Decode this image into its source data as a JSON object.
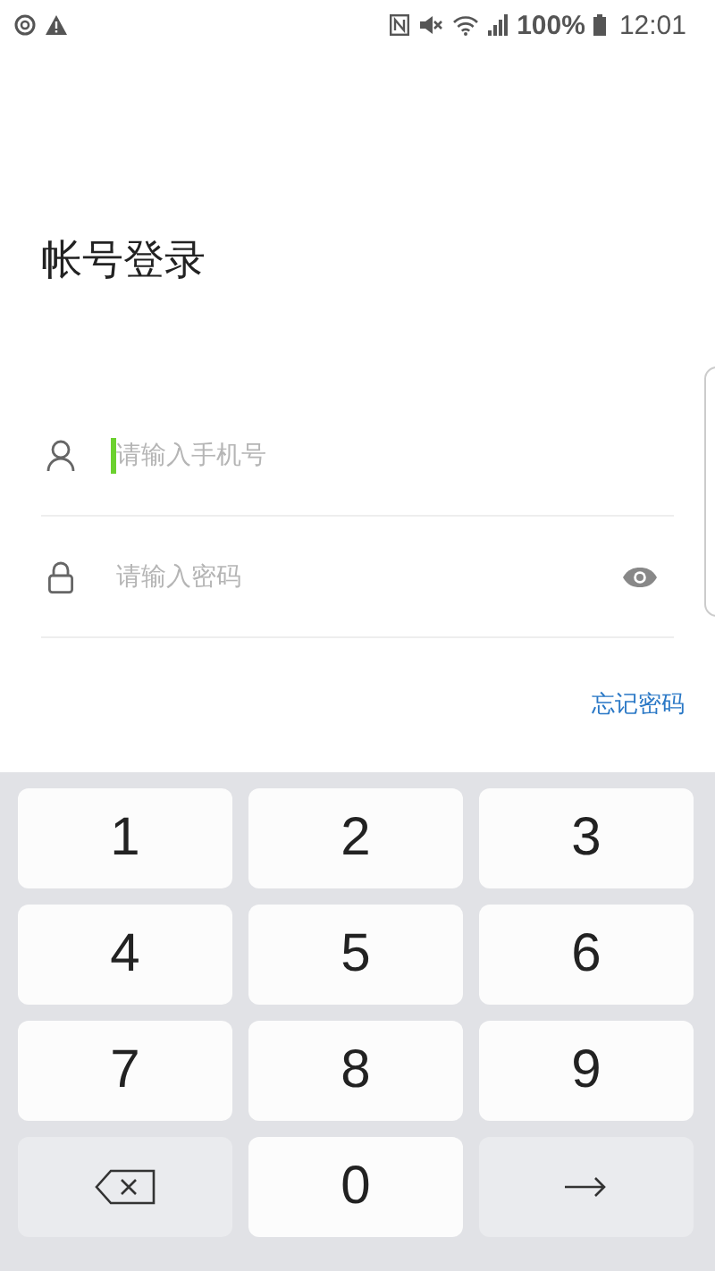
{
  "status_bar": {
    "battery": "100%",
    "time": "12:01"
  },
  "title": "帐号登录",
  "fields": [
    {
      "kind": "user",
      "placeholder": "请输入手机号",
      "focused": true
    },
    {
      "kind": "password",
      "placeholder": "请输入密码",
      "focused": false
    }
  ],
  "forgot_link": "忘记密码",
  "keypad": [
    {
      "kind": "digit",
      "label": "1"
    },
    {
      "kind": "digit",
      "label": "2"
    },
    {
      "kind": "digit",
      "label": "3"
    },
    {
      "kind": "digit",
      "label": "4"
    },
    {
      "kind": "digit",
      "label": "5"
    },
    {
      "kind": "digit",
      "label": "6"
    },
    {
      "kind": "digit",
      "label": "7"
    },
    {
      "kind": "digit",
      "label": "8"
    },
    {
      "kind": "digit",
      "label": "9"
    },
    {
      "kind": "delete"
    },
    {
      "kind": "digit",
      "label": "0"
    },
    {
      "kind": "next"
    }
  ]
}
